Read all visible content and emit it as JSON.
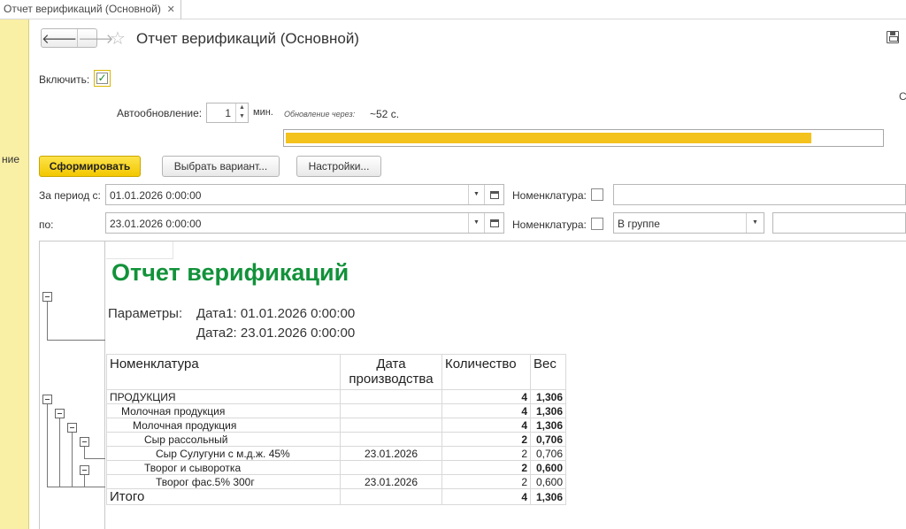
{
  "tab": {
    "title": "Отчет верификаций (Основной)",
    "close": "✕"
  },
  "leftpanel": {
    "cut_label": "ние"
  },
  "header": {
    "back": "🡐",
    "forward": "🡒",
    "star": "☆",
    "title": "Отчет верификаций (Основной)"
  },
  "settings": {
    "enable_label": "Включить:",
    "enable_checked": "✓",
    "cut_right": "С",
    "auto_label": "Автообновление:",
    "auto_value": "1",
    "spin_up": "▲",
    "spin_down": "▼",
    "auto_unit": "мин.",
    "next_label": "Обновление через:",
    "next_value": "~52 с.",
    "progress_fraction": 0.88
  },
  "buttons": {
    "generate": "Сформировать",
    "choose_variant": "Выбрать вариант...",
    "settings": "Настройки..."
  },
  "filters": {
    "from_label": "За период с:",
    "from_value": "01.01.2026  0:00:00",
    "to_label": "по:",
    "to_value": "23.01.2026  0:00:00",
    "nom_label_1": "Номенклатура:",
    "nom_label_2": "Номенклатура:",
    "nom_mode": "В группе",
    "dropdown": "▼"
  },
  "report": {
    "title": "Отчет верификаций",
    "params_label": "Параметры:",
    "param1": "Дата1: 01.01.2026 0:00:00",
    "param2": "Дата2: 23.01.2026 0:00:00",
    "columns": [
      "Номенклатура",
      "Дата\nпроизводства",
      "Количество",
      "Вес"
    ],
    "rows": [
      {
        "name": "ПРОДУКЦИЯ",
        "indent": 0,
        "date": "",
        "qty": "4",
        "weight": "1,306",
        "bold": true
      },
      {
        "name": "Молочная продукция",
        "indent": 1,
        "date": "",
        "qty": "4",
        "weight": "1,306",
        "bold": true
      },
      {
        "name": "Молочная продукция",
        "indent": 2,
        "date": "",
        "qty": "4",
        "weight": "1,306",
        "bold": true
      },
      {
        "name": "Сыр рассольный",
        "indent": 3,
        "date": "",
        "qty": "2",
        "weight": "0,706",
        "bold": true
      },
      {
        "name": "Сыр Сулугуни с м.д.ж. 45%",
        "indent": 4,
        "date": "23.01.2026",
        "qty": "2",
        "weight": "0,706",
        "bold": false
      },
      {
        "name": "Творог и сыворотка",
        "indent": 3,
        "date": "",
        "qty": "2",
        "weight": "0,600",
        "bold": true
      },
      {
        "name": "Творог фас.5%  300г",
        "indent": 4,
        "date": "23.01.2026",
        "qty": "2",
        "weight": "0,600",
        "bold": false
      }
    ],
    "total": {
      "label": "Итого",
      "qty": "4",
      "weight": "1,306"
    }
  }
}
